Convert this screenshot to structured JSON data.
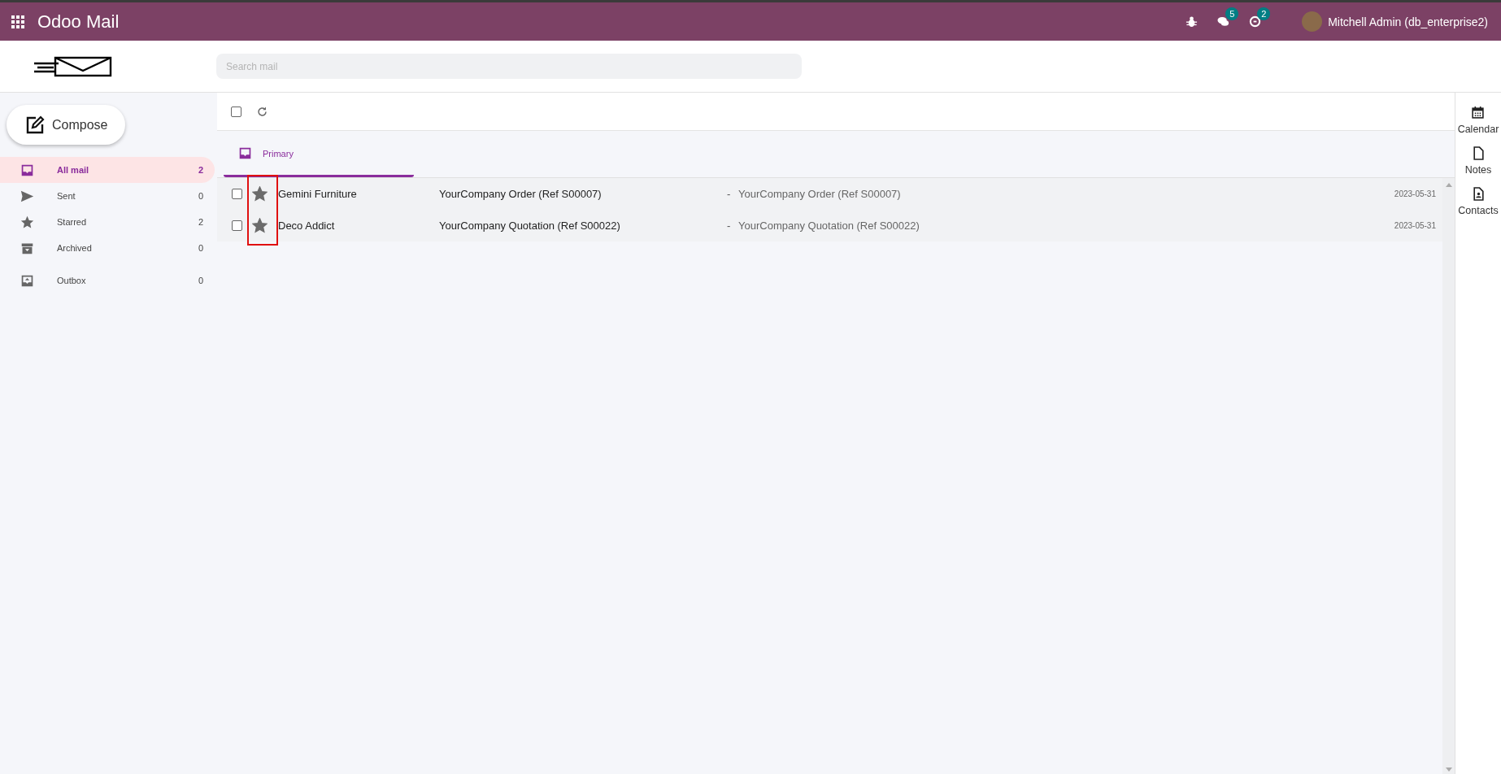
{
  "navbar": {
    "app_title": "Odoo Mail",
    "chat_count": "5",
    "activity_count": "2",
    "user": "Mitchell Admin (db_enterprise2)"
  },
  "search": {
    "placeholder": "Search mail"
  },
  "compose": {
    "label": "Compose"
  },
  "folders": [
    {
      "kind": "inbox",
      "label": "All mail",
      "count": "2",
      "selected": true
    },
    {
      "kind": "sent",
      "label": "Sent",
      "count": "0",
      "selected": false
    },
    {
      "kind": "starred",
      "label": "Starred",
      "count": "2",
      "selected": false
    },
    {
      "kind": "archived",
      "label": "Archived",
      "count": "0",
      "selected": false
    },
    {
      "kind": "outbox",
      "label": "Outbox",
      "count": "0",
      "selected": false
    }
  ],
  "toolbar": {
    "select_all_checked": false
  },
  "tabs": [
    {
      "label": "Primary",
      "selected": true
    }
  ],
  "messages": [
    {
      "checked": false,
      "starred": true,
      "sender": "Gemini Furniture",
      "subject": "YourCompany Order (Ref S00007)",
      "separator": "-",
      "preview": "YourCompany Order (Ref S00007)",
      "date": "2023-05-31"
    },
    {
      "checked": false,
      "starred": true,
      "sender": "Deco Addict",
      "subject": "YourCompany Quotation (Ref S00022)",
      "separator": "-",
      "preview": "YourCompany Quotation (Ref S00022)",
      "date": "2023-05-31"
    }
  ],
  "side_apps": [
    {
      "kind": "calendar",
      "label": "Calendar"
    },
    {
      "kind": "notes",
      "label": "Notes"
    },
    {
      "kind": "contacts",
      "label": "Contacts"
    }
  ]
}
